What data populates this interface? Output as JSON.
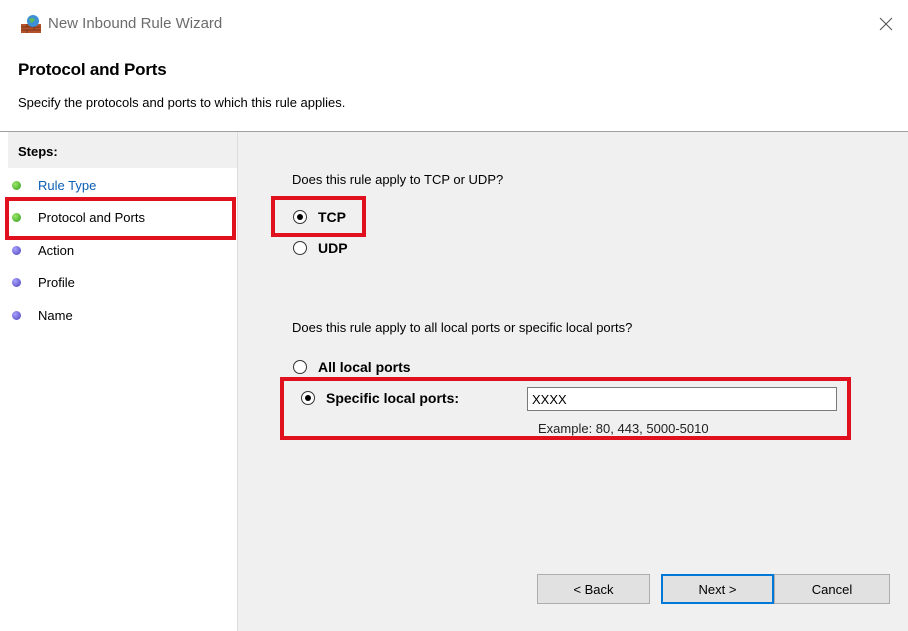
{
  "window": {
    "title": "New Inbound Rule Wizard",
    "close_icon": "close-icon",
    "app_icon": "firewall-icon"
  },
  "header": {
    "title": "Protocol and Ports",
    "subtitle": "Specify the protocols and ports to which this rule applies."
  },
  "steps": {
    "heading": "Steps:",
    "items": [
      {
        "label": "Rule Type",
        "state": "completed",
        "color": "#2f9a17"
      },
      {
        "label": "Protocol and Ports",
        "state": "current",
        "color": "#2f9a17"
      },
      {
        "label": "Action",
        "state": "pending",
        "color": "#4a3fb8"
      },
      {
        "label": "Profile",
        "state": "pending",
        "color": "#4a3fb8"
      },
      {
        "label": "Name",
        "state": "pending",
        "color": "#4a3fb8"
      }
    ]
  },
  "protocol": {
    "question": "Does this rule apply to TCP or UDP?",
    "options": [
      {
        "label": "TCP",
        "selected": true
      },
      {
        "label": "UDP",
        "selected": false
      }
    ]
  },
  "ports": {
    "question": "Does this rule apply to all local ports or specific local ports?",
    "options": [
      {
        "label": "All local ports",
        "selected": false
      },
      {
        "label": "Specific local ports:",
        "selected": true
      }
    ],
    "input_value": "XXXX",
    "example": "Example: 80, 443, 5000-5010"
  },
  "buttons": {
    "back": "< Back",
    "next": "Next >",
    "cancel": "Cancel"
  },
  "colors": {
    "highlight": "#e0101e",
    "panel_bg": "#f0f0f0",
    "link": "#0b5fb5"
  }
}
